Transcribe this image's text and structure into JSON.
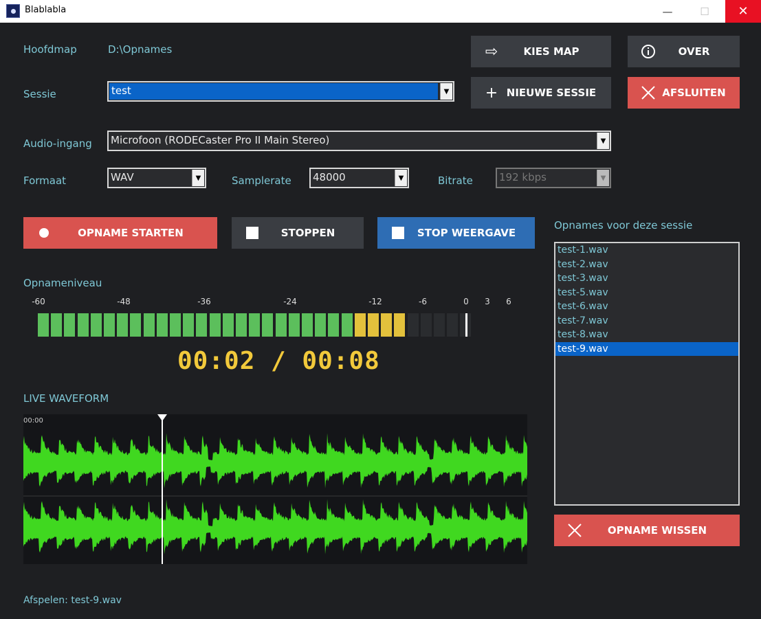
{
  "window": {
    "title": "Blablabla",
    "minimize": "—",
    "maximize": "☐",
    "close": "✕"
  },
  "labels": {
    "hoofdmap": "Hoofdmap",
    "sessie": "Sessie",
    "audio_ingang": "Audio-ingang",
    "formaat": "Formaat",
    "samplerate": "Samplerate",
    "bitrate": "Bitrate",
    "opnameniveau": "Opnameniveau",
    "live_waveform": "LIVE WAVEFORM",
    "opnames_sessie": "Opnames voor deze sessie"
  },
  "hoofdmap_path": "D:\\Opnames",
  "combos": {
    "sessie": "test",
    "audio_ingang": "Microfoon (RODECaster Pro II Main Stereo)",
    "formaat": "WAV",
    "samplerate": "48000",
    "bitrate": "192 kbps"
  },
  "buttons": {
    "kies_map": "KIES MAP",
    "over": "OVER",
    "nieuwe_sessie": "NIEUWE SESSIE",
    "afsluiten": "AFSLUITEN",
    "opname_starten": "OPNAME STARTEN",
    "stoppen": "STOPPEN",
    "stop_weergave": "STOP WEERGAVE",
    "opname_wissen": "OPNAME WISSEN"
  },
  "icons": {
    "kies_map": "arrow-right-icon",
    "over": "info-icon",
    "nieuwe_sessie": "plus-icon",
    "afsluiten": "close-icon",
    "opname_starten": "record-dot-icon",
    "stoppen": "stop-square-icon",
    "stop_weergave": "stop-square-icon",
    "opname_wissen": "close-icon"
  },
  "meter": {
    "ticks": [
      "-60",
      "-48",
      "-36",
      "-24",
      "-12",
      "-6",
      "0",
      "3",
      "6"
    ],
    "level_db": -3,
    "colors": {
      "green": "#5cbf5c",
      "yellow": "#e3c13c",
      "off": "#2a2c2f"
    }
  },
  "playback_time": "00:02 / 00:08",
  "waveform": {
    "time_label": "00:00",
    "color": "#40d820",
    "playhead_fraction": 0.275
  },
  "recordings": [
    "test-1.wav",
    "test-2.wav",
    "test-3.wav",
    "test-5.wav",
    "test-6.wav",
    "test-7.wav",
    "test-8.wav",
    "test-9.wav"
  ],
  "selected_recording": "test-9.wav",
  "status": "Afspelen: test-9.wav",
  "colors": {
    "accent_text": "#7fc8d6",
    "red_button": "#d9534f",
    "blue_button": "#2e6db4",
    "time": "#f2c93b"
  }
}
